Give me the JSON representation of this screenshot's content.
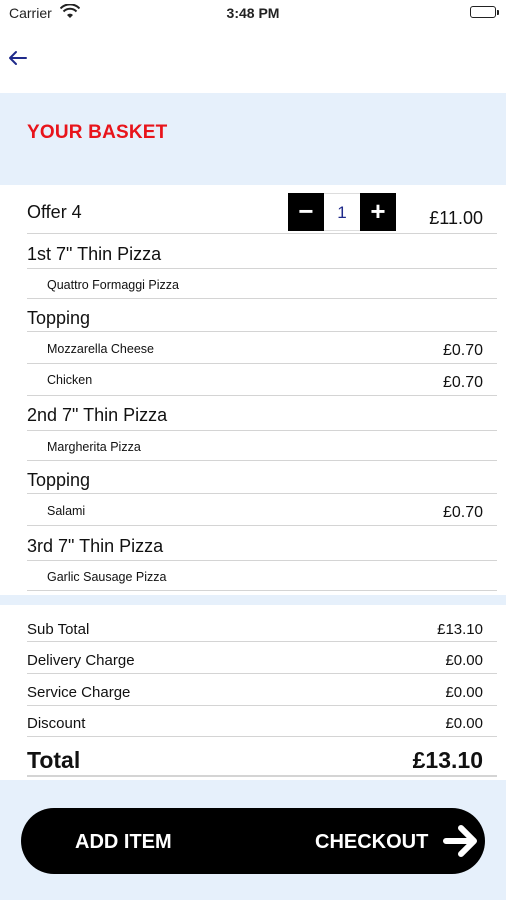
{
  "status_bar": {
    "carrier": "Carrier",
    "time": "3:48 PM"
  },
  "header": {
    "title": "YOUR BASKET"
  },
  "offer": {
    "name": "Offer 4",
    "quantity": "1",
    "price": "£11.00",
    "minus": "−",
    "plus": "+"
  },
  "items": [
    {
      "type": "group",
      "label": "1st 7\" Thin Pizza",
      "price": ""
    },
    {
      "type": "sub",
      "label": "Quattro Formaggi Pizza",
      "price": ""
    },
    {
      "type": "group",
      "label": "Topping",
      "price": ""
    },
    {
      "type": "sub",
      "label": "Mozzarella Cheese",
      "price": "£0.70"
    },
    {
      "type": "sub",
      "label": "Chicken",
      "price": "£0.70"
    },
    {
      "type": "group",
      "label": "2nd 7\" Thin Pizza",
      "price": ""
    },
    {
      "type": "sub",
      "label": "Margherita Pizza",
      "price": ""
    },
    {
      "type": "group",
      "label": "Topping",
      "price": ""
    },
    {
      "type": "sub",
      "label": "Salami",
      "price": "£0.70"
    },
    {
      "type": "group",
      "label": "3rd 7\" Thin Pizza",
      "price": ""
    },
    {
      "type": "sub",
      "label": "Garlic Sausage Pizza",
      "price": ""
    }
  ],
  "summary": {
    "sub_total": {
      "label": "Sub Total",
      "value": "£13.10"
    },
    "delivery": {
      "label": "Delivery Charge",
      "value": "£0.00"
    },
    "service": {
      "label": "Service Charge",
      "value": "£0.00"
    },
    "discount": {
      "label": "Discount",
      "value": "£0.00"
    },
    "total": {
      "label": "Total",
      "value": "£13.10"
    }
  },
  "actions": {
    "add_item": "ADD ITEM",
    "checkout": "CHECKOUT"
  },
  "colors": {
    "accent_red": "#e8141b",
    "band_blue": "#e6f0fb",
    "qty_blue": "#1f2a8a"
  },
  "icons": {
    "back": "arrow-left-icon",
    "checkout": "arrow-right-icon",
    "wifi": "wifi-icon",
    "battery": "battery-icon"
  }
}
